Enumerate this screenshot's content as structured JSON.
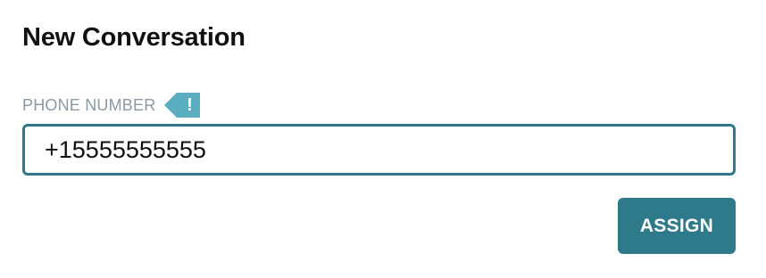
{
  "dialog": {
    "title": "New Conversation"
  },
  "phone_field": {
    "label": "PHONE NUMBER",
    "value": "+15555555555",
    "alert_icon": "exclamation-icon",
    "alert_glyph": "!"
  },
  "actions": {
    "assign_label": "ASSIGN"
  },
  "colors": {
    "accent": "#2e7a8a",
    "label_gray": "#8a9aa3",
    "alert_tag": "#5aaec0",
    "title_text": "#111111"
  }
}
